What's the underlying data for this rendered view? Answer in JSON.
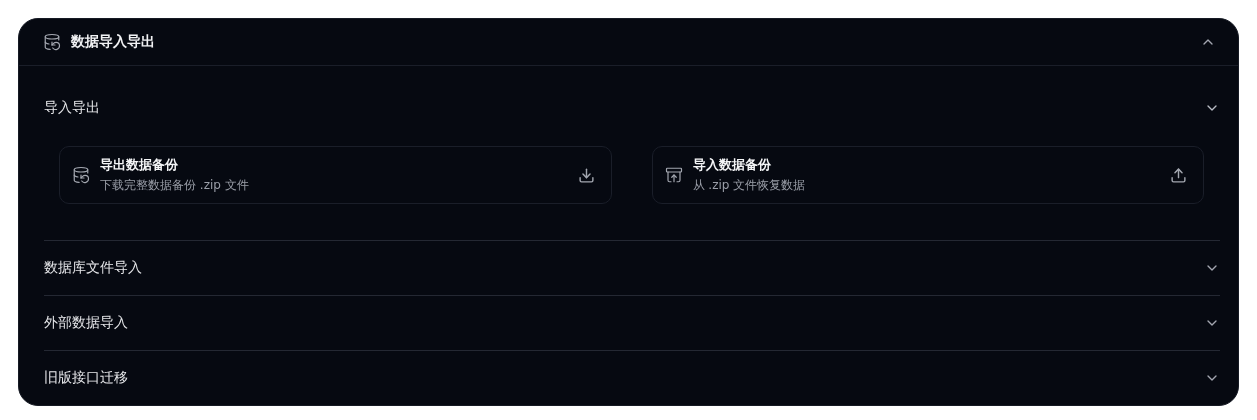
{
  "panel": {
    "title": "数据导入导出",
    "expanded": true
  },
  "sections": [
    {
      "title": "导入导出",
      "expanded": true,
      "cards": [
        {
          "kind": "export",
          "title": "导出数据备份",
          "description": "下载完整数据备份 .zip 文件"
        },
        {
          "kind": "import",
          "title": "导入数据备份",
          "description": "从 .zip 文件恢复数据"
        }
      ]
    },
    {
      "title": "数据库文件导入",
      "expanded": false
    },
    {
      "title": "外部数据导入",
      "expanded": false
    },
    {
      "title": "旧版接口迁移",
      "expanded": false
    }
  ]
}
